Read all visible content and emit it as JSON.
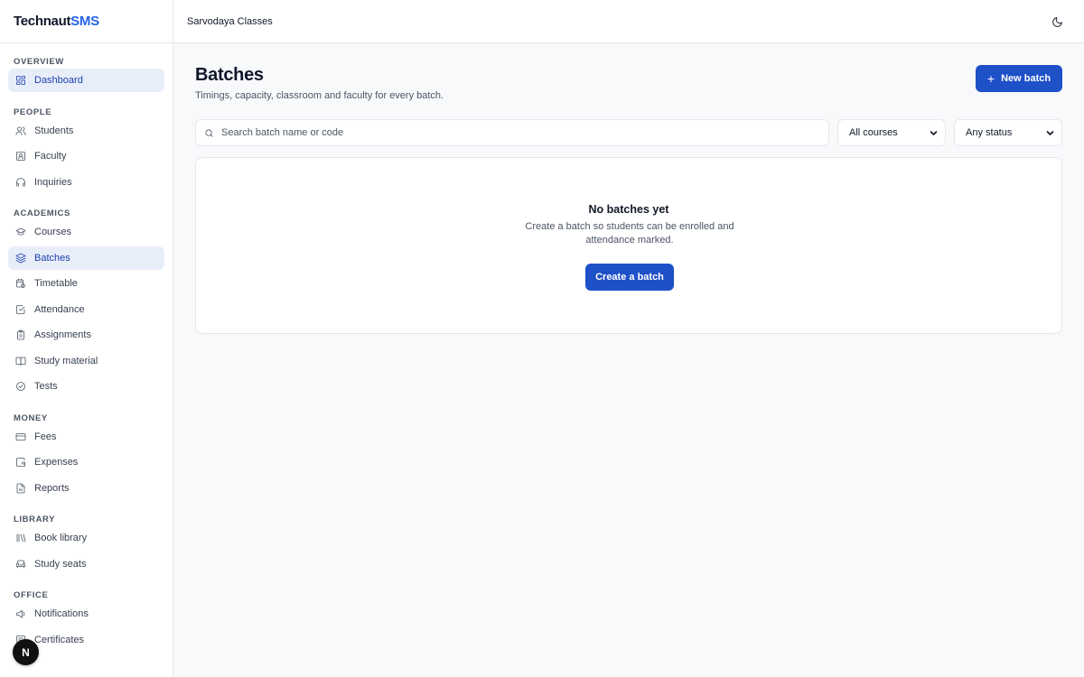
{
  "brand": {
    "name_main": "Technaut",
    "name_accent": "SMS"
  },
  "org_name": "Sarvodaya Classes",
  "sidebar": {
    "sections": [
      {
        "label": "OVERVIEW",
        "items": [
          {
            "label": "Dashboard",
            "icon": "dashboard-icon"
          }
        ]
      },
      {
        "label": "PEOPLE",
        "items": [
          {
            "label": "Students",
            "icon": "users-icon"
          },
          {
            "label": "Faculty",
            "icon": "id-card-icon"
          },
          {
            "label": "Inquiries",
            "icon": "headset-icon"
          }
        ]
      },
      {
        "label": "ACADEMICS",
        "items": [
          {
            "label": "Courses",
            "icon": "graduation-cap-icon"
          },
          {
            "label": "Batches",
            "icon": "layers-icon"
          },
          {
            "label": "Timetable",
            "icon": "calendar-clock-icon"
          },
          {
            "label": "Attendance",
            "icon": "check-square-icon"
          },
          {
            "label": "Assignments",
            "icon": "clipboard-icon"
          },
          {
            "label": "Study material",
            "icon": "book-open-icon"
          },
          {
            "label": "Tests",
            "icon": "check-circle-icon"
          }
        ]
      },
      {
        "label": "MONEY",
        "items": [
          {
            "label": "Fees",
            "icon": "credit-card-icon"
          },
          {
            "label": "Expenses",
            "icon": "wallet-icon"
          },
          {
            "label": "Reports",
            "icon": "file-chart-icon"
          }
        ]
      },
      {
        "label": "LIBRARY",
        "items": [
          {
            "label": "Book library",
            "icon": "library-icon"
          },
          {
            "label": "Study seats",
            "icon": "armchair-icon"
          }
        ]
      },
      {
        "label": "OFFICE",
        "items": [
          {
            "label": "Notifications",
            "icon": "megaphone-icon"
          },
          {
            "label": "Certificates",
            "icon": "certificate-icon"
          }
        ]
      }
    ],
    "active_items": [
      "Dashboard",
      "Batches"
    ]
  },
  "page": {
    "title": "Batches",
    "subtitle": "Timings, capacity, classroom and faculty for every batch.",
    "new_button": "New batch"
  },
  "filters": {
    "search_placeholder": "Search batch name or code",
    "search_value": "",
    "course_selected": "All courses",
    "status_selected": "Any status"
  },
  "empty_state": {
    "title": "No batches yet",
    "description": "Create a batch so students can be enrolled and attendance marked.",
    "button": "Create a batch"
  },
  "fab_letter": "N",
  "colors": {
    "accent": "#1e50c8",
    "active_bg": "#e8eef9",
    "active_text": "#1e40af",
    "brand_accent": "#2563eb"
  }
}
